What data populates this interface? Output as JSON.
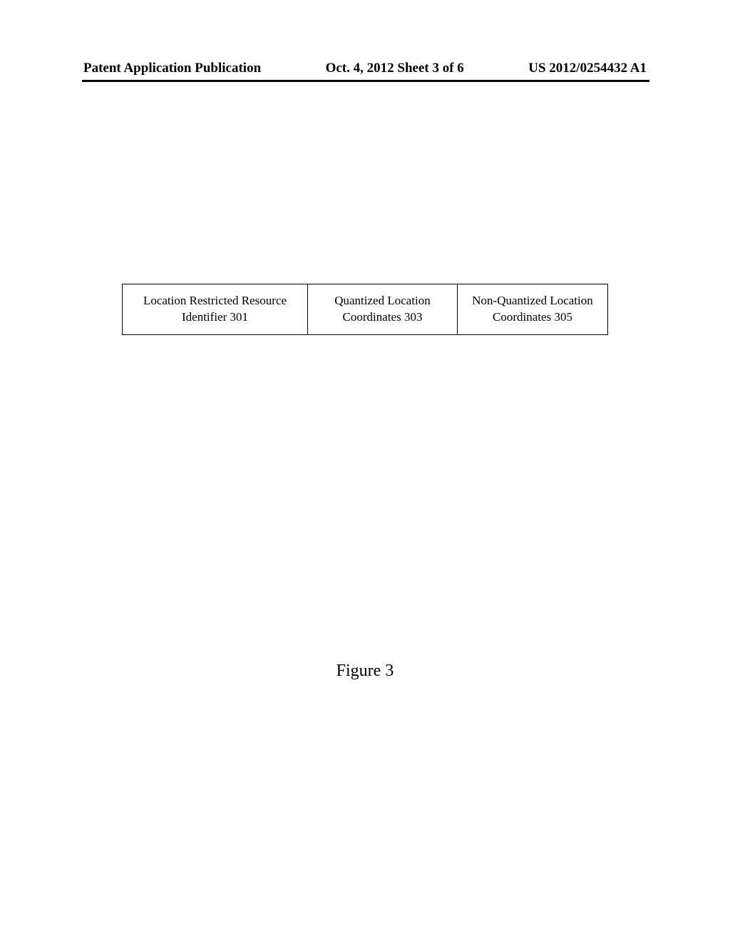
{
  "header": {
    "left": "Patent Application Publication",
    "center": "Oct. 4, 2012   Sheet 3 of 6",
    "right": "US 2012/0254432 A1"
  },
  "table": {
    "cell1_line1": "Location Restricted Resource",
    "cell1_line2": "Identifier 301",
    "cell2_line1": "Quantized Location",
    "cell2_line2": "Coordinates 303",
    "cell3_line1": "Non-Quantized Location",
    "cell3_line2": "Coordinates 305"
  },
  "figure_caption": "Figure 3"
}
